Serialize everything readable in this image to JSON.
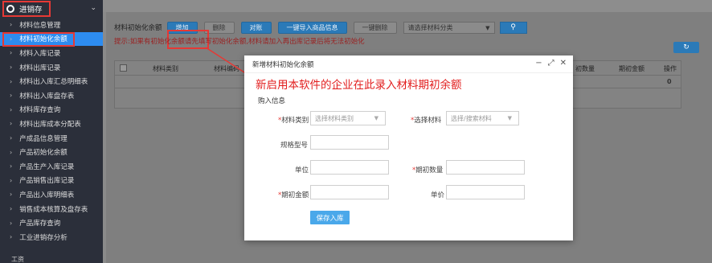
{
  "sidebar": {
    "header": "进销存",
    "items": [
      {
        "label": "材料信息管理"
      },
      {
        "label": "材料初始化余额",
        "active": true
      },
      {
        "label": "材料入库记录"
      },
      {
        "label": "材料出库记录"
      },
      {
        "label": "材料出入库汇总明细表"
      },
      {
        "label": "材料出入库盘存表"
      },
      {
        "label": "材料库存查询"
      },
      {
        "label": "材料出库成本分配表"
      },
      {
        "label": "产成品信息管理"
      },
      {
        "label": "产品初始化余额"
      },
      {
        "label": "产品生产入库记录"
      },
      {
        "label": "产品销售出库记录"
      },
      {
        "label": "产品出入库明细表"
      },
      {
        "label": "销售成本核算及盘存表"
      },
      {
        "label": "产品库存查询"
      },
      {
        "label": "工业进销存分析"
      }
    ],
    "footer": "工资"
  },
  "toolbar": {
    "label": "材料初始化余额",
    "add": "增加",
    "delete": "删除",
    "compare": "对账",
    "import": "一键导入商品信息",
    "delete_all": "一键删除",
    "category_placeholder": "请选择材料分类"
  },
  "hint": "提示:如果有初始化余额请先填写初始化余额,材料请加入再出库记录后将无法初始化",
  "grid": {
    "columns": [
      "材料类别",
      "材料编码",
      "初数量",
      "期初金额",
      "操作"
    ],
    "row_action": "0"
  },
  "modal": {
    "title": "新增材料初始化余额",
    "note": "新启用本软件的企业在此录入材料期初余额",
    "section": "购入信息",
    "fields": {
      "category_label": "材料类别",
      "category_placeholder": "选择材料类别",
      "material_label": "选择材料",
      "material_placeholder": "选择/搜索材料",
      "spec_label": "规格型号",
      "unit_label": "单位",
      "qty_label": "期初数量",
      "amount_label": "期初金额",
      "price_label": "单价"
    },
    "save": "保存入库"
  },
  "colors": {
    "sidebar_bg": "#2b2f3a",
    "active_blue": "#2d8cf0",
    "annotation_red": "#e53935",
    "save_button": "#4aa8ea"
  }
}
